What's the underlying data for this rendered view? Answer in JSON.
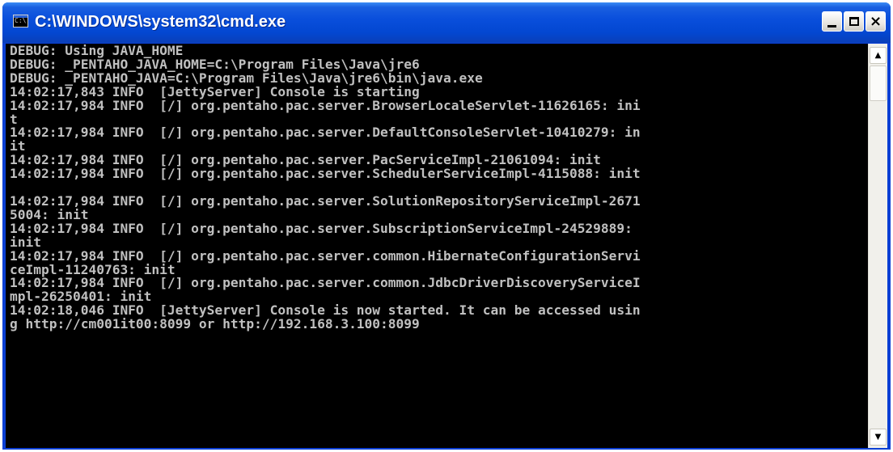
{
  "window": {
    "title": "C:\\WINDOWS\\system32\\cmd.exe",
    "icon_label": "C:\\"
  },
  "titlebar_buttons": {
    "minimize": "minimize-icon",
    "maximize": "maximize-icon",
    "close_glyph": "×"
  },
  "console": {
    "lines": [
      "DEBUG: Using JAVA_HOME",
      "DEBUG: _PENTAHO_JAVA_HOME=C:\\Program Files\\Java\\jre6",
      "DEBUG: _PENTAHO_JAVA=C:\\Program Files\\Java\\jre6\\bin\\java.exe",
      "14:02:17,843 INFO  [JettyServer] Console is starting",
      "14:02:17,984 INFO  [/] org.pentaho.pac.server.BrowserLocaleServlet-11626165: ini",
      "t",
      "14:02:17,984 INFO  [/] org.pentaho.pac.server.DefaultConsoleServlet-10410279: in",
      "it",
      "14:02:17,984 INFO  [/] org.pentaho.pac.server.PacServiceImpl-21061094: init",
      "14:02:17,984 INFO  [/] org.pentaho.pac.server.SchedulerServiceImpl-4115088: init",
      "",
      "14:02:17,984 INFO  [/] org.pentaho.pac.server.SolutionRepositoryServiceImpl-2671",
      "5004: init",
      "14:02:17,984 INFO  [/] org.pentaho.pac.server.SubscriptionServiceImpl-24529889:",
      "init",
      "14:02:17,984 INFO  [/] org.pentaho.pac.server.common.HibernateConfigurationServi",
      "ceImpl-11240763: init",
      "14:02:17,984 INFO  [/] org.pentaho.pac.server.common.JdbcDriverDiscoveryServiceI",
      "mpl-26250401: init",
      "14:02:18,046 INFO  [JettyServer] Console is now started. It can be accessed usin",
      "g http://cm001it00:8099 or http://192.168.3.100:8099"
    ]
  },
  "scrollbar": {
    "up_glyph": "▲",
    "down_glyph": "▼"
  }
}
